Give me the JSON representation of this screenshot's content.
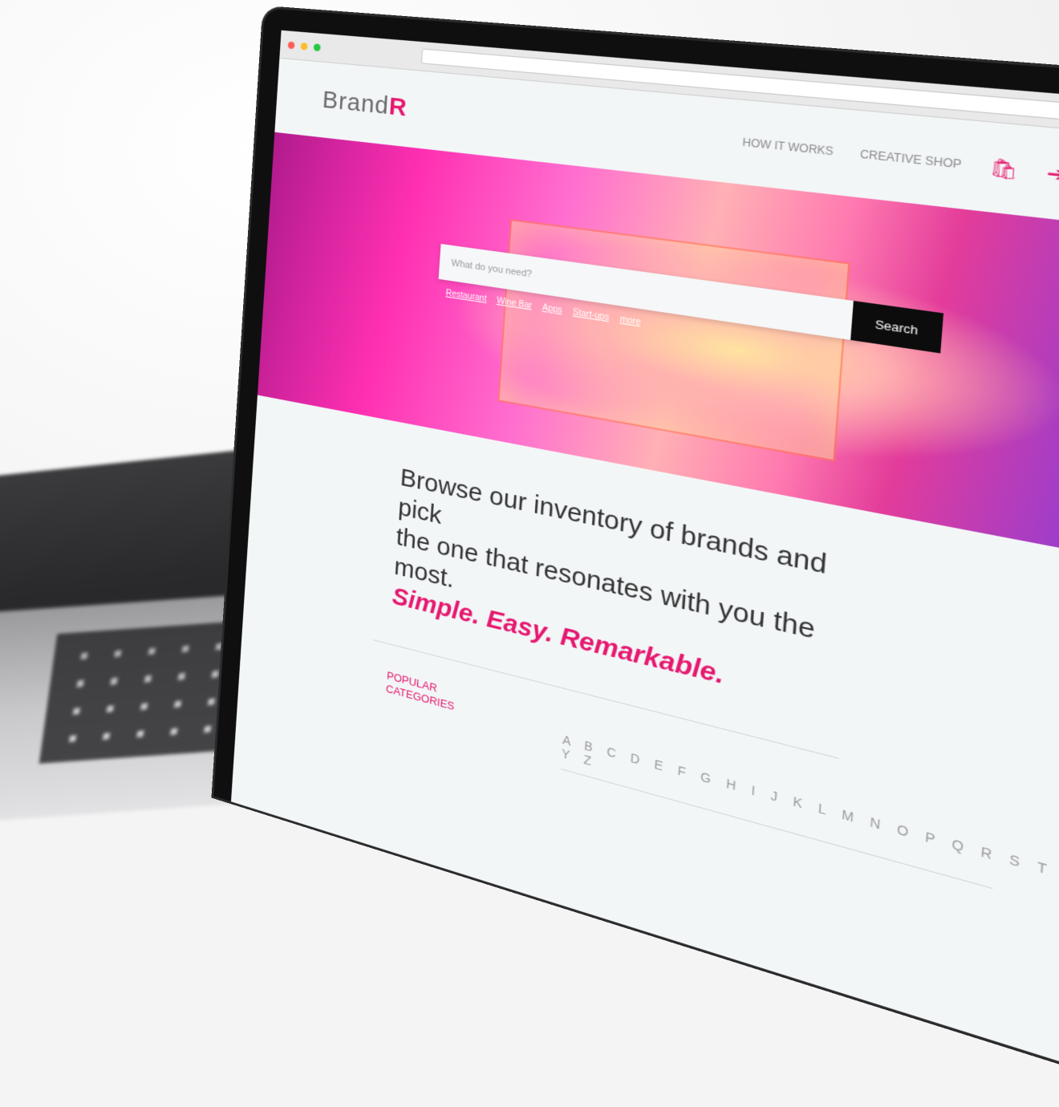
{
  "site": {
    "logo_text": "Brand",
    "logo_accent": "R",
    "nav": [
      "HOW IT WORKS",
      "CREATIVE SHOP"
    ],
    "icons": [
      "bag-icon",
      "login-icon",
      "menu-icon"
    ]
  },
  "hero": {
    "search_placeholder": "What do you need?",
    "search_button": "Search",
    "quick_links": [
      "Restaurant",
      "Wine Bar",
      "Apps",
      "Start-ups",
      "more"
    ]
  },
  "content": {
    "tagline_line1": "Browse our inventory of brands and pick",
    "tagline_line2": "the one that resonates with you the most.",
    "tagline_accent": "Simple. Easy. Remarkable.",
    "popular_label": "POPULAR CATEGORIES",
    "alphabet": "A B C D E F G H I J K L M N O P Q R S T U V W X Y Z"
  },
  "colors": {
    "accent": "#e6186f",
    "dark": "#0c0c0c"
  }
}
